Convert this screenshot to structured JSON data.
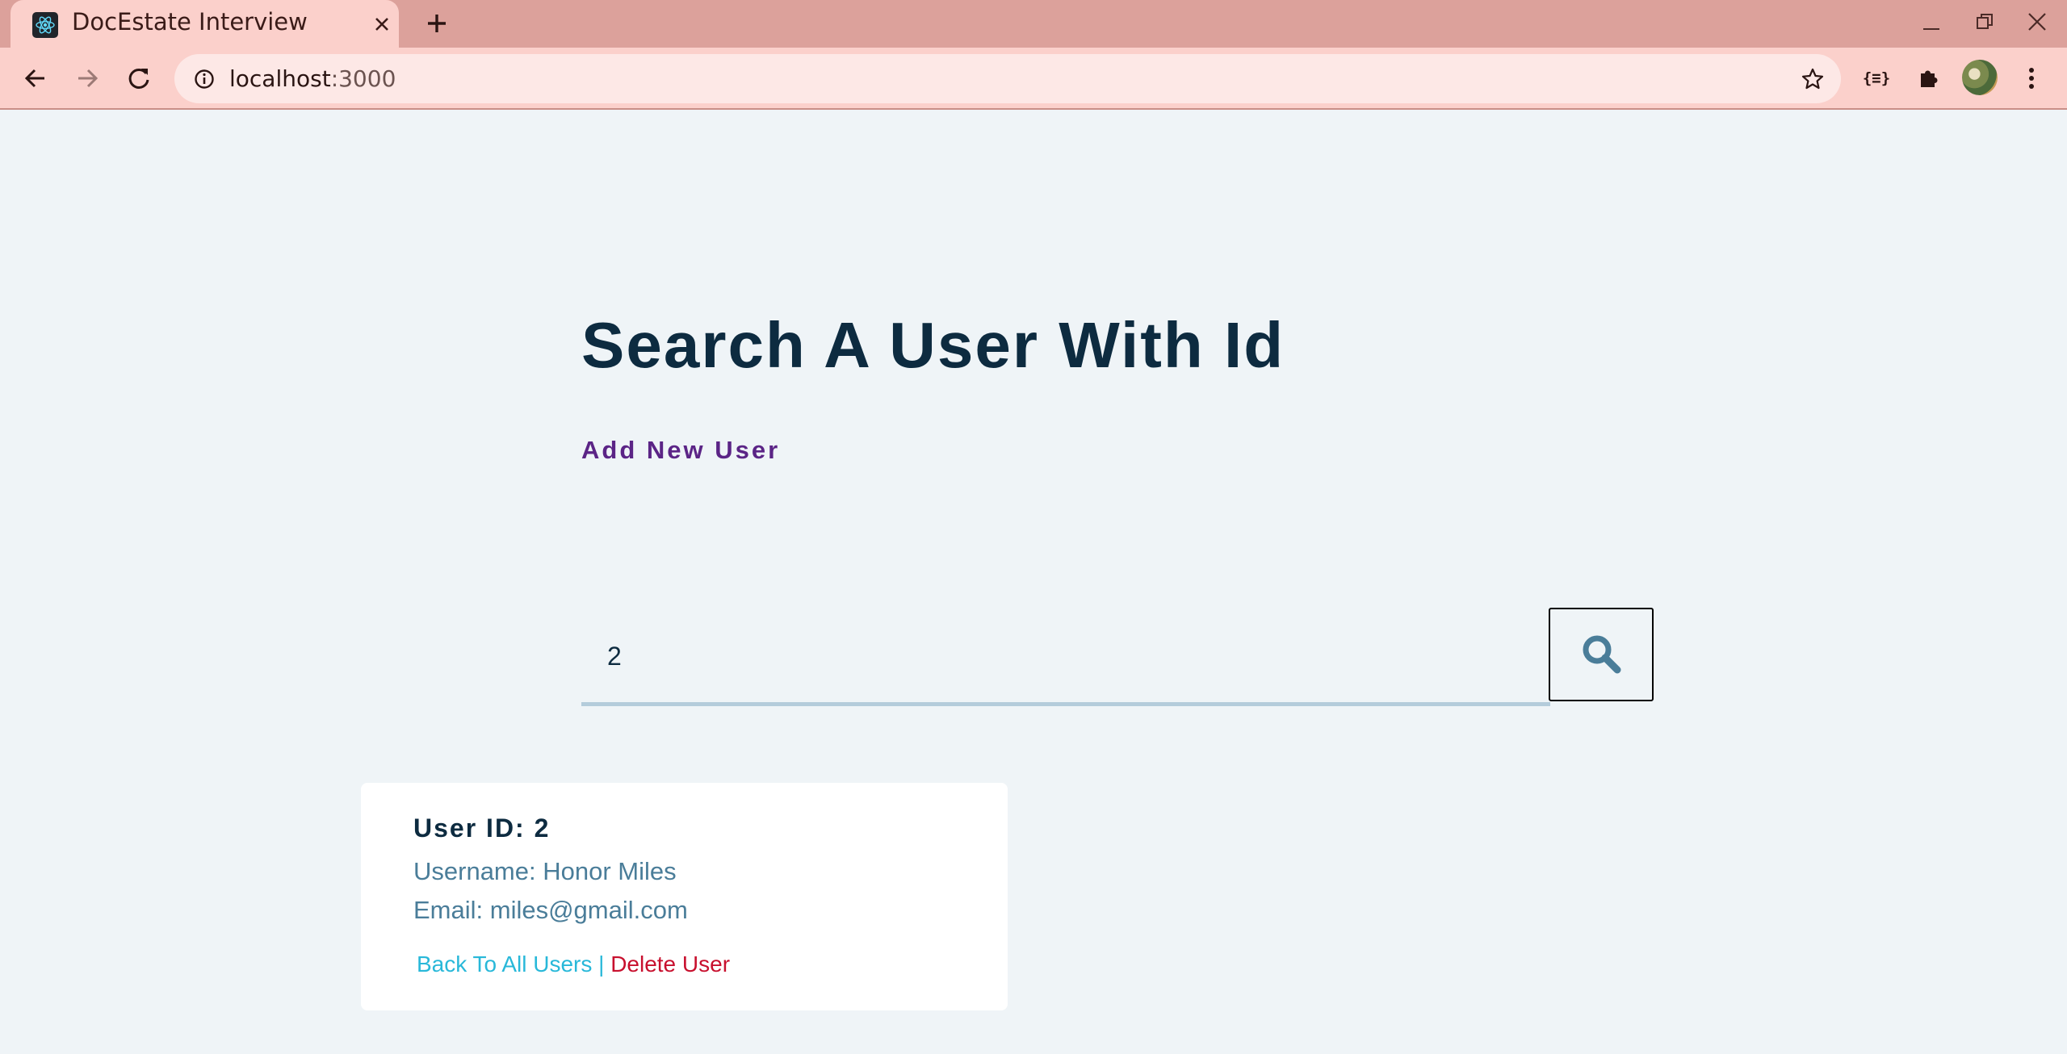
{
  "browser": {
    "tab_title": "DocEstate Interview",
    "url_host": "localhost",
    "url_port": ":3000"
  },
  "page": {
    "title": "Search A User With Id",
    "add_user_link": "Add New User",
    "search_value": "2"
  },
  "user_card": {
    "id_label": "User ID: 2",
    "username_label": "Username: Honor Miles",
    "email_label": "Email: miles@gmail.com",
    "back_link": "Back To All Users",
    "separator": " | ",
    "delete_link": "Delete User"
  },
  "colors": {
    "page_bg": "#eff4f7",
    "title": "#0d2b40",
    "add_link": "#5b2486",
    "card_text": "#4a7d99",
    "back_link": "#28b8d9",
    "delete_link": "#c8102e",
    "chrome_frame": "#dca19b",
    "chrome_toolbar": "#fbd0cb"
  },
  "icons": {
    "favicon": "react-icon",
    "search": "search-icon"
  }
}
